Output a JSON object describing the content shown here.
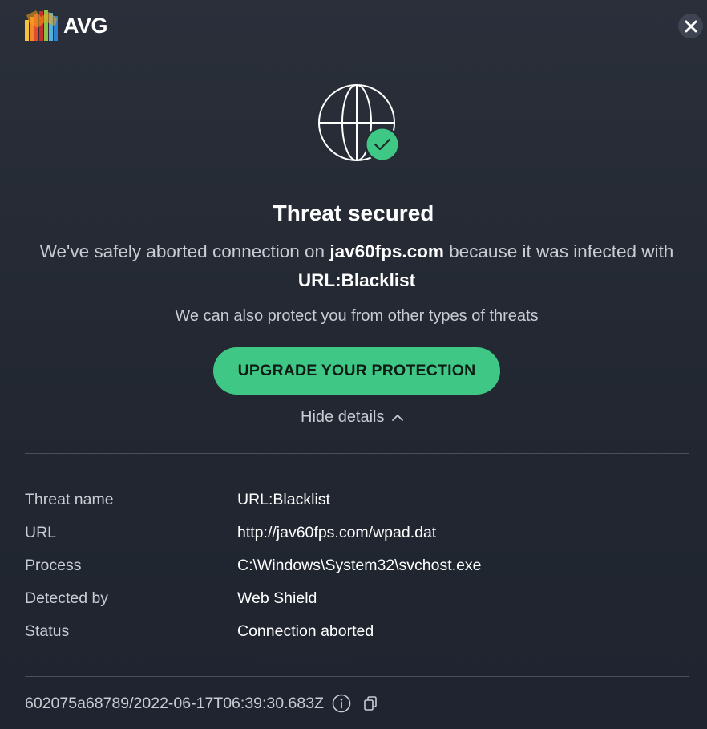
{
  "brand": {
    "name": "AVG"
  },
  "header": {
    "close_icon": "close-icon"
  },
  "hero": {
    "icon": "globe-check-icon"
  },
  "title": "Threat secured",
  "message": {
    "prefix": "We've safely aborted connection on ",
    "site": "jav60fps.com",
    "middle": " because it was infected with ",
    "threat": "URL:Blacklist"
  },
  "sub_message": "We can also protect you from other types of threats",
  "upgrade_button": "UPGRADE YOUR PROTECTION",
  "hide_details": "Hide details",
  "details": [
    {
      "label": "Threat name",
      "value": "URL:Blacklist"
    },
    {
      "label": "URL",
      "value": "http://jav60fps.com/wpad.dat"
    },
    {
      "label": "Process",
      "value": "C:\\Windows\\System32\\svchost.exe"
    },
    {
      "label": "Detected by",
      "value": "Web Shield"
    },
    {
      "label": "Status",
      "value": "Connection aborted"
    }
  ],
  "footer": {
    "id": "602075a68789/2022-06-17T06:39:30.683Z"
  },
  "colors": {
    "accent": "#3ec785",
    "background": "#262b35",
    "muted_text": "#c9ccd3"
  }
}
